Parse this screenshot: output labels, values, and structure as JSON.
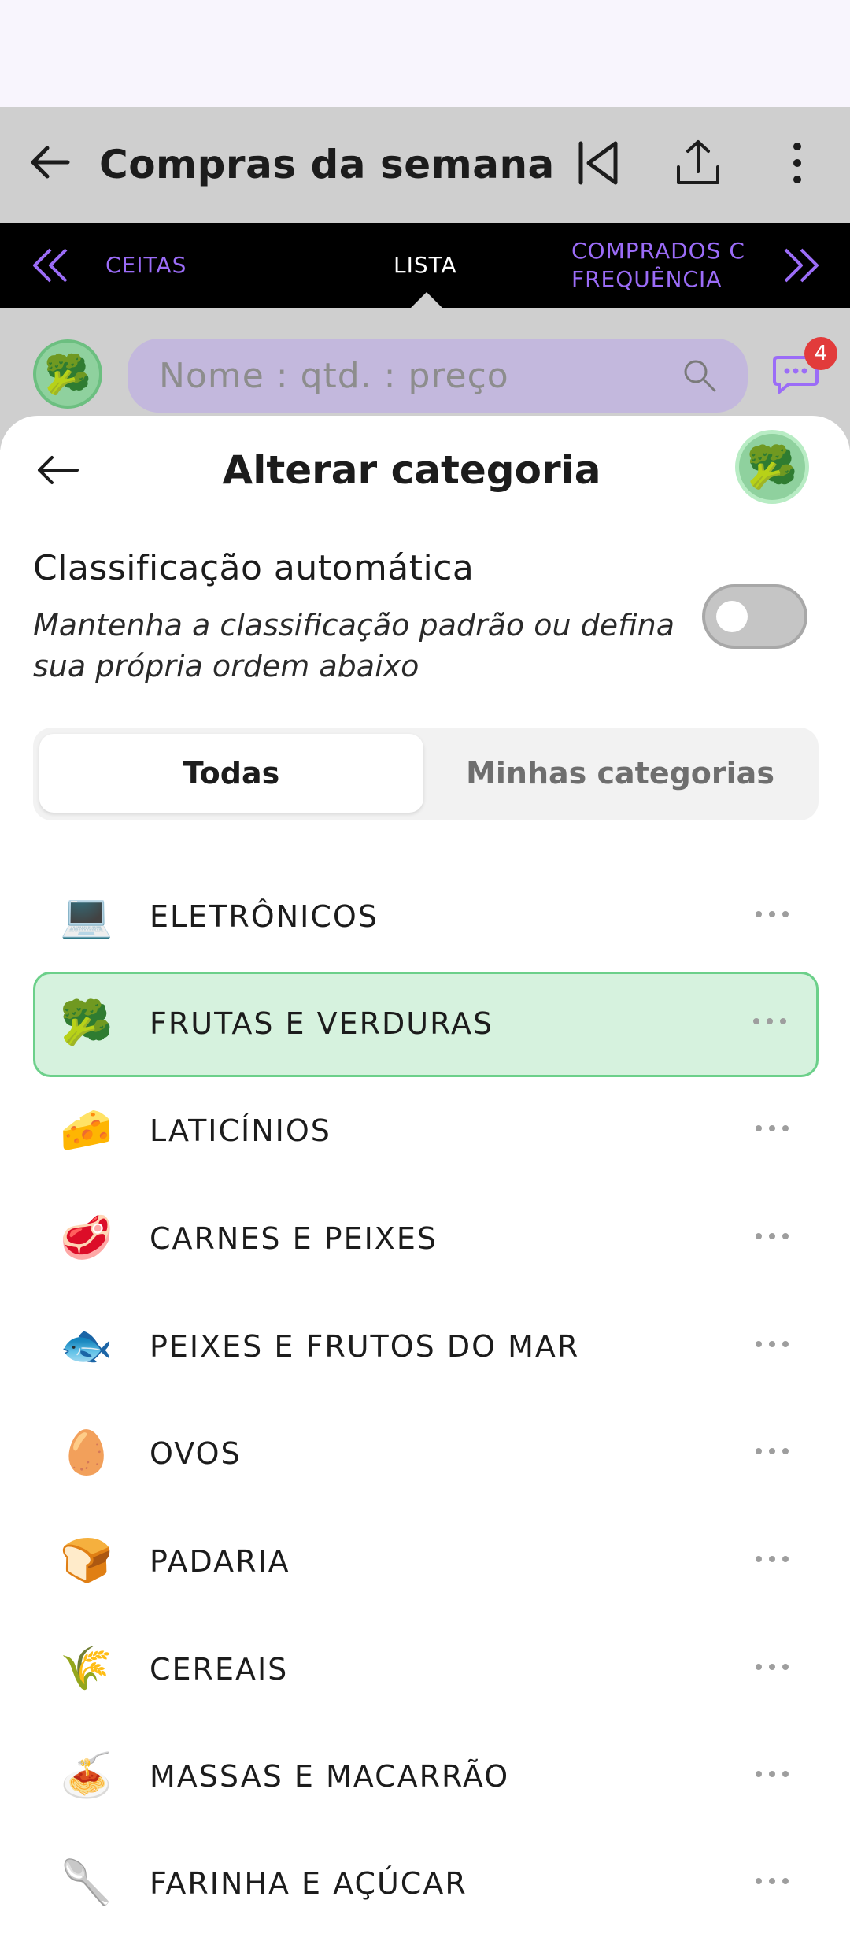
{
  "appbar": {
    "title": "Compras da semana"
  },
  "tabs": {
    "left": "CEITAS",
    "middle": "LISTA",
    "right": "COMPRADOS C",
    "right_line2": "FREQUÊNCIA"
  },
  "search": {
    "placeholder": "Nome : qtd. : preço",
    "chat_badge": "4"
  },
  "sheet": {
    "title": "Alterar categoria",
    "auto_title": "Classificação automática",
    "auto_desc": "Mantenha a classificação padrão ou defina sua própria ordem abaixo",
    "toggle_on": false,
    "segment": {
      "all": "Todas",
      "mine": "Minhas categorias"
    }
  },
  "categories": [
    {
      "emoji": "💻",
      "label": "ELETRÔNICOS"
    },
    {
      "emoji": "🥦",
      "label": "FRUTAS E VERDURAS"
    },
    {
      "emoji": "🧀",
      "label": "LATICÍNIOS"
    },
    {
      "emoji": "🥩",
      "label": "CARNES E PEIXES"
    },
    {
      "emoji": "🐟",
      "label": "PEIXES E FRUTOS DO MAR"
    },
    {
      "emoji": "🥚",
      "label": "OVOS"
    },
    {
      "emoji": "🍞",
      "label": "PADARIA"
    },
    {
      "emoji": "🌾",
      "label": "CEREAIS"
    },
    {
      "emoji": "🍝",
      "label": "MASSAS E MACARRÃO"
    },
    {
      "emoji": "🥄",
      "label": "FARINHA E AÇÚCAR"
    }
  ],
  "selected_category": "FRUTAS E VERDURAS",
  "colors": {
    "accent": "#9b6cf7",
    "selected_bg": "#d6f2de",
    "selected_border": "#6cd08a",
    "badge": "#e23b3b"
  }
}
